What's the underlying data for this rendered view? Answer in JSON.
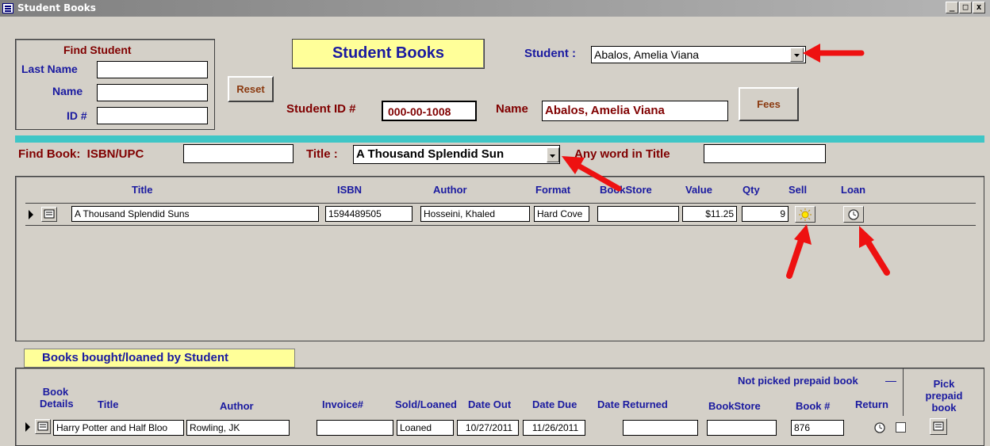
{
  "window": {
    "title": "Student Books",
    "min": "_",
    "max": "□",
    "close": "x"
  },
  "find_student": {
    "title": "Find Student",
    "last_name_label": "Last Name",
    "name_label": "Name",
    "id_label": "ID #",
    "last_name_value": "",
    "name_value": "",
    "id_value": ""
  },
  "reset_label": "Reset",
  "form_title": "Student Books",
  "student": {
    "label": "Student :",
    "value": "Abalos, Amelia Viana"
  },
  "student_id": {
    "label": "Student ID #",
    "value": "000-00-1008"
  },
  "name_field": {
    "label": "Name",
    "value": "Abalos, Amelia Viana"
  },
  "fees_label": "Fees",
  "find_book": {
    "isbn_label": "Find Book:  ISBN/UPC",
    "isbn_value": "",
    "title_label": "Title :",
    "title_value": "A Thousand Splendid Sun",
    "anyword_label": "Any word in Title",
    "anyword_value": ""
  },
  "books_grid": {
    "headers": {
      "title": "Title",
      "isbn": "ISBN",
      "author": "Author",
      "format": "Format",
      "bookstore": "BookStore",
      "value": "Value",
      "qty": "Qty",
      "sell": "Sell",
      "loan": "Loan"
    },
    "rows": [
      {
        "title": "A Thousand Splendid Suns",
        "isbn": "1594489505",
        "author": "Hosseini, Khaled",
        "format": "Hard Cove",
        "bookstore": "",
        "value": "$11.25",
        "qty": "9"
      }
    ]
  },
  "history": {
    "tab_label": "Books bought/loaned by Student",
    "headers": {
      "book_details": "Book Details",
      "title": "Title",
      "author": "Author",
      "invoice": "Invoice#",
      "sold_loaned": "Sold/Loaned",
      "date_out": "Date Out",
      "date_due": "Date Due",
      "date_returned": "Date Returned",
      "not_picked": "Not picked prepaid book",
      "bookstore": "BookStore",
      "book_num": "Book #",
      "return": "Return",
      "pick_prepaid": "Pick prepaid book"
    },
    "rows": [
      {
        "title": "Harry Potter and Half Bloo",
        "author": "Rowling, JK",
        "invoice": "",
        "sold_loaned": "Loaned",
        "date_out": "10/27/2011",
        "date_due": "11/26/2011",
        "date_returned": "",
        "bookstore": "",
        "book_num": "876"
      }
    ]
  },
  "colors": {
    "form_bg": "#d4d0c8",
    "teal_bar": "#3fc6c6",
    "yellow": "#ffff99",
    "arrow": "#ee1111"
  }
}
